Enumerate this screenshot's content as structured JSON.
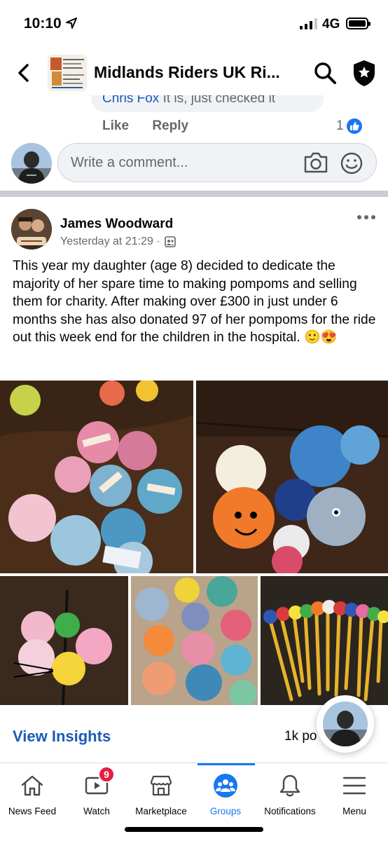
{
  "status_bar": {
    "time": "10:10",
    "network": "4G"
  },
  "header": {
    "group_name": "Midlands Riders UK Ri..."
  },
  "previous_comment": {
    "author": "Chris Fox",
    "snippet": " It is, just checked it",
    "like_label": "Like",
    "reply_label": "Reply",
    "like_count": "1"
  },
  "comment_input": {
    "placeholder": "Write a comment..."
  },
  "post": {
    "author": "James Woodward",
    "timestamp": "Yesterday at 21:29 ·",
    "text": "This year my daughter (age 8) decided to dedicate the majority of her spare time to making pompoms and selling them for charity. After making over £300 in just under 6 months she has also donated 97 of her pompoms for the ride out this week end for the children in the hospital. 🙂😍",
    "photo_count": 5
  },
  "insights": {
    "link_label": "View Insights",
    "reach_text": "1k po"
  },
  "tabs": [
    {
      "label": "News Feed",
      "icon": "home-icon"
    },
    {
      "label": "Watch",
      "icon": "watch-icon",
      "badge": "9"
    },
    {
      "label": "Marketplace",
      "icon": "marketplace-icon"
    },
    {
      "label": "Groups",
      "icon": "groups-icon",
      "active": true
    },
    {
      "label": "Notifications",
      "icon": "bell-icon"
    },
    {
      "label": "Menu",
      "icon": "menu-icon"
    }
  ],
  "colors": {
    "accent": "#1877f2",
    "link": "#1c5ab8",
    "badge": "#e41e3f",
    "secondary_text": "#65676b"
  }
}
